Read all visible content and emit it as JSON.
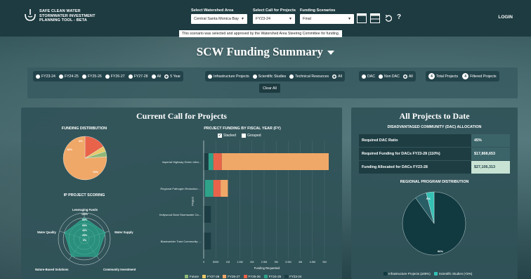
{
  "header": {
    "brand_line1": "SAFE CLEAN WATER",
    "brand_line2": "STORMWATER INVESTMENT",
    "brand_line3": "PLANNING TOOL - BETA",
    "watershed_label": "Select Watershed Area",
    "watershed_value": "Central Santa Monica Bay",
    "call_label": "Select Call for Projects",
    "call_value": "FY23-24",
    "scenario_label": "Funding Scenarios",
    "scenario_value": "Final",
    "notice": "This scenario was selected and approved by the Watershed Area Steering Committee for funding.",
    "help": "?",
    "login": "LOGIN"
  },
  "page_title": "SCW Funding Summary",
  "filters": {
    "years": [
      "FY23-24",
      "FY24-25",
      "FY25-26",
      "FY26-27",
      "FY27-28",
      "All",
      "5 Year"
    ],
    "years_selected": "5 Year",
    "types": [
      "Infrastructure Projects",
      "Scientific Studies",
      "Technical Resources",
      "All"
    ],
    "types_selected": "All",
    "dac": [
      "DAC",
      "Non DAC",
      "All"
    ],
    "dac_selected": "All",
    "total_projects_label": "Total Projects",
    "total_projects_count": "4",
    "filtered_projects_label": "Filtered Projects",
    "filtered_projects_count": "4",
    "clear_all": "Clear All"
  },
  "current_call": {
    "title": "Current Call for Projects",
    "funding_distribution": {
      "title": "FUNDING DISTRIBUTION",
      "labels": [
        "76%",
        "16%",
        "4%"
      ]
    },
    "ip_scoring": {
      "title": "IP PROJECT SCORING",
      "axes": [
        "Leveraging Funds",
        "Water Supply",
        "Community Investment",
        "Nature-Based Solutions",
        "Water Quality"
      ],
      "ring_labels": [
        "100%",
        "80%",
        "60%",
        "40%",
        "20%",
        "0%"
      ]
    },
    "project_funding": {
      "title": "PROJECT FUNDING BY FISCAL YEAR (FY)",
      "stacked_label": "Stacked",
      "grouped_label": "Grouped",
      "ylabel": "Project",
      "xlabel": "Funding Requested",
      "projects": [
        "Imperial Highway Green Infra...",
        "Regional Pathogen Reduction ...",
        "Hollywood Bowl Stormwater Ca...",
        "Blackwelder Tract Community ..."
      ],
      "xticks": [
        "0",
        "500K",
        "1M",
        "1.5M",
        "2M",
        "2.5M",
        "3M",
        "3.5M",
        "4M",
        "4.5M",
        "5M"
      ],
      "legend": [
        "Future",
        "FY27-28",
        "FY26-27",
        "FY25-26",
        "FY24-25",
        "FY23-24"
      ]
    }
  },
  "all_projects": {
    "title": "All Projects to Date",
    "dac_title": "DISADVANTAGED COMMUNITY (DAC) ALLOCATION",
    "rows": [
      {
        "k": "Required DAC Ratio",
        "v": "45%"
      },
      {
        "k": "Required Funding for DACs FY23-28 (110%)",
        "v": "$17,868,653"
      },
      {
        "k": "Funding Allocated for DACs FY23-28",
        "v": "$27,106,313"
      }
    ],
    "regional_title": "REGIONAL PROGRAM DISTRIBUTION",
    "pie_labels": [
      "6%",
      "90%"
    ],
    "legend": [
      "Infrastructure Projects (≥85%)",
      "Scientific Studies (<5%)"
    ]
  },
  "chart_data": [
    {
      "type": "pie",
      "title": "FUNDING DISTRIBUTION",
      "values": [
        76,
        16,
        4,
        4
      ],
      "labels": [
        "76%",
        "16%",
        "4%",
        ""
      ],
      "colors": [
        "#f0a868",
        "#e8634a",
        "#e8c86a",
        "#8fb878"
      ]
    },
    {
      "type": "bar",
      "orientation": "horizontal",
      "title": "PROJECT FUNDING BY FISCAL YEAR (FY)",
      "categories": [
        "Imperial Highway Green Infra...",
        "Regional Pathogen Reduction ...",
        "Hollywood Bowl Stormwater Ca...",
        "Blackwelder Tract Community ..."
      ],
      "xlabel": "Funding Requested",
      "ylabel": "Project",
      "xlim": [
        0,
        5000000
      ],
      "series": [
        {
          "name": "FY23-24",
          "color": "#1c3d44",
          "values": [
            200000,
            50000,
            300000,
            300000
          ]
        },
        {
          "name": "FY24-25",
          "color": "#2fa389",
          "values": [
            200000,
            350000,
            0,
            0
          ]
        },
        {
          "name": "FY25-26",
          "color": "#e8634a",
          "values": [
            350000,
            300000,
            0,
            0
          ]
        },
        {
          "name": "FY26-27",
          "color": "#f0a868",
          "values": [
            4700000,
            300000,
            0,
            0
          ]
        },
        {
          "name": "FY27-28",
          "color": "#e8c86a",
          "values": [
            0,
            0,
            0,
            0
          ]
        },
        {
          "name": "Future",
          "color": "#8fb878",
          "values": [
            0,
            0,
            0,
            0
          ]
        }
      ]
    },
    {
      "type": "pie",
      "title": "REGIONAL PROGRAM DISTRIBUTION",
      "values": [
        90,
        6,
        4
      ],
      "labels": [
        "90%",
        "6%",
        ""
      ],
      "colors": [
        "#113a40",
        "#2a5e66",
        "#35c0b4"
      ]
    }
  ],
  "colors": {
    "header": "#1d3b40",
    "panel": "#305258",
    "accent_orange": "#f0a868",
    "accent_teal": "#35c0b4"
  }
}
